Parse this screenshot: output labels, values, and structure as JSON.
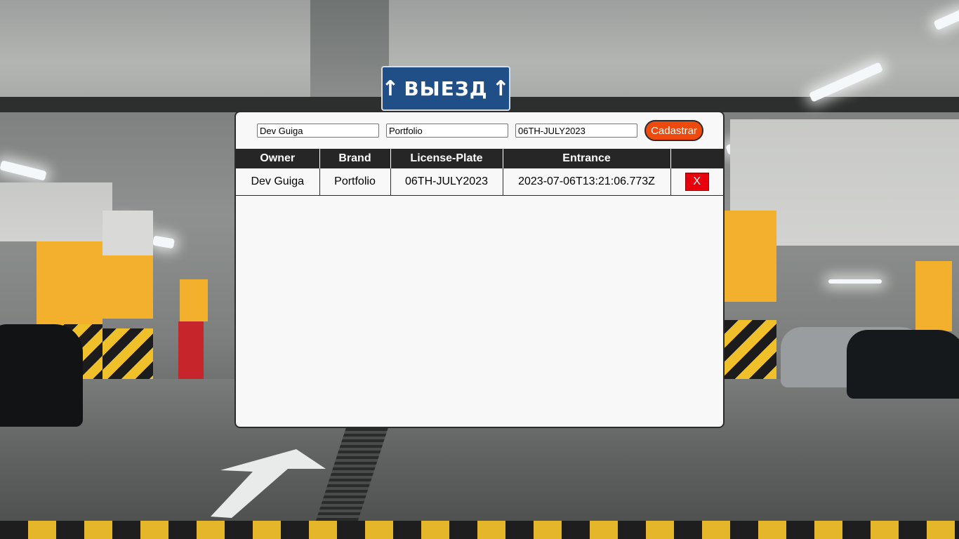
{
  "background": {
    "sign_text": "ВЫЕЗД",
    "scene": "parking-garage"
  },
  "form": {
    "owner_value": "Dev Guiga",
    "brand_value": "Portfolio",
    "plate_value": "06TH-JULY2023",
    "submit_label": "Cadastrar"
  },
  "table": {
    "headers": [
      "Owner",
      "Brand",
      "License-Plate",
      "Entrance",
      ""
    ],
    "rows": [
      {
        "owner": "Dev Guiga",
        "brand": "Portfolio",
        "plate": "06TH-JULY2023",
        "entrance": "2023-07-06T13:21:06.773Z",
        "delete_label": "X"
      }
    ]
  },
  "colors": {
    "accent": "#ee4a0e",
    "delete": "#e8000c",
    "header_bg": "#262626",
    "panel_bg": "#f8f8f8"
  }
}
